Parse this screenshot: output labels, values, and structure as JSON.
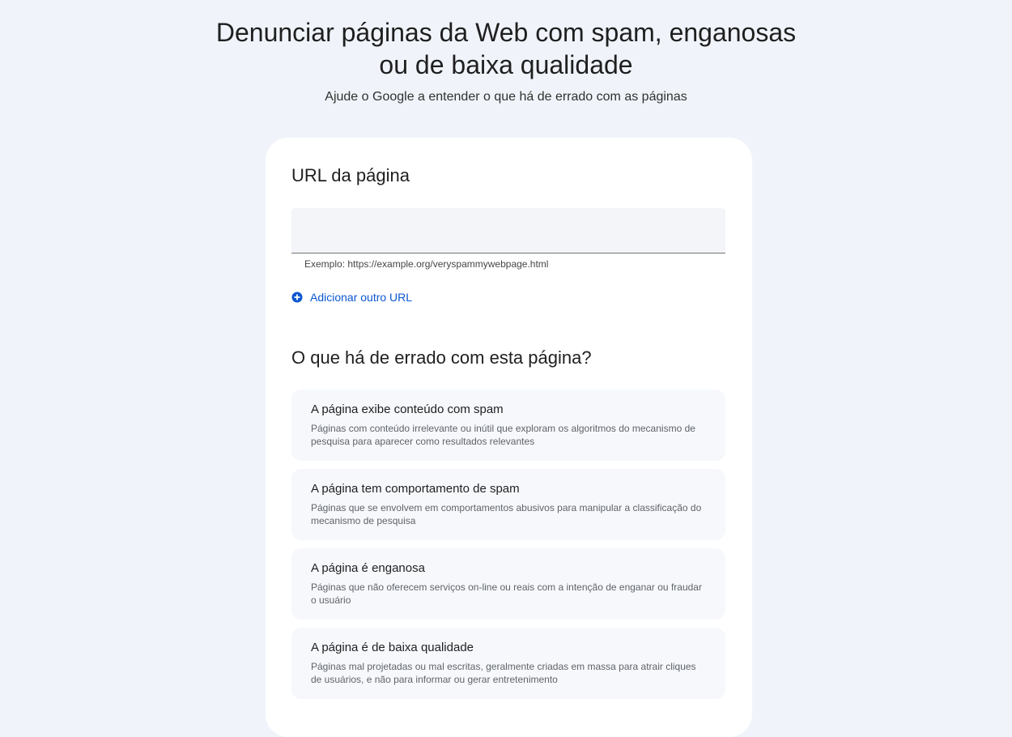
{
  "header": {
    "title": "Denunciar páginas da Web com spam, enganosas ou de baixa qualidade",
    "subtitle": "Ajude o Google a entender o que há de errado com as páginas"
  },
  "url_section": {
    "heading": "URL da página",
    "input_value": "",
    "hint": "Exemplo: https://example.org/veryspammywebpage.html",
    "add_url_label": "Adicionar outro URL"
  },
  "reason_section": {
    "heading": "O que há de errado com esta página?",
    "options": [
      {
        "title": "A página exibe conteúdo com spam",
        "description": "Páginas com conteúdo irrelevante ou inútil que exploram os algoritmos do mecanismo de pesquisa para aparecer como resultados relevantes"
      },
      {
        "title": "A página tem comportamento de spam",
        "description": "Páginas que se envolvem em comportamentos abusivos para manipular a classificação do mecanismo de pesquisa"
      },
      {
        "title": "A página é enganosa",
        "description": "Páginas que não oferecem serviços on-line ou reais com a intenção de enganar ou fraudar o usuário"
      },
      {
        "title": "A página é de baixa qualidade",
        "description": "Páginas mal projetadas ou mal escritas, geralmente criadas em massa para atrair cliques de usuários, e não para informar ou gerar entretenimento"
      }
    ]
  },
  "colors": {
    "background": "#f0f4fa",
    "card": "#ffffff",
    "accent": "#0b57d0",
    "option_background": "#f6f8fc"
  }
}
